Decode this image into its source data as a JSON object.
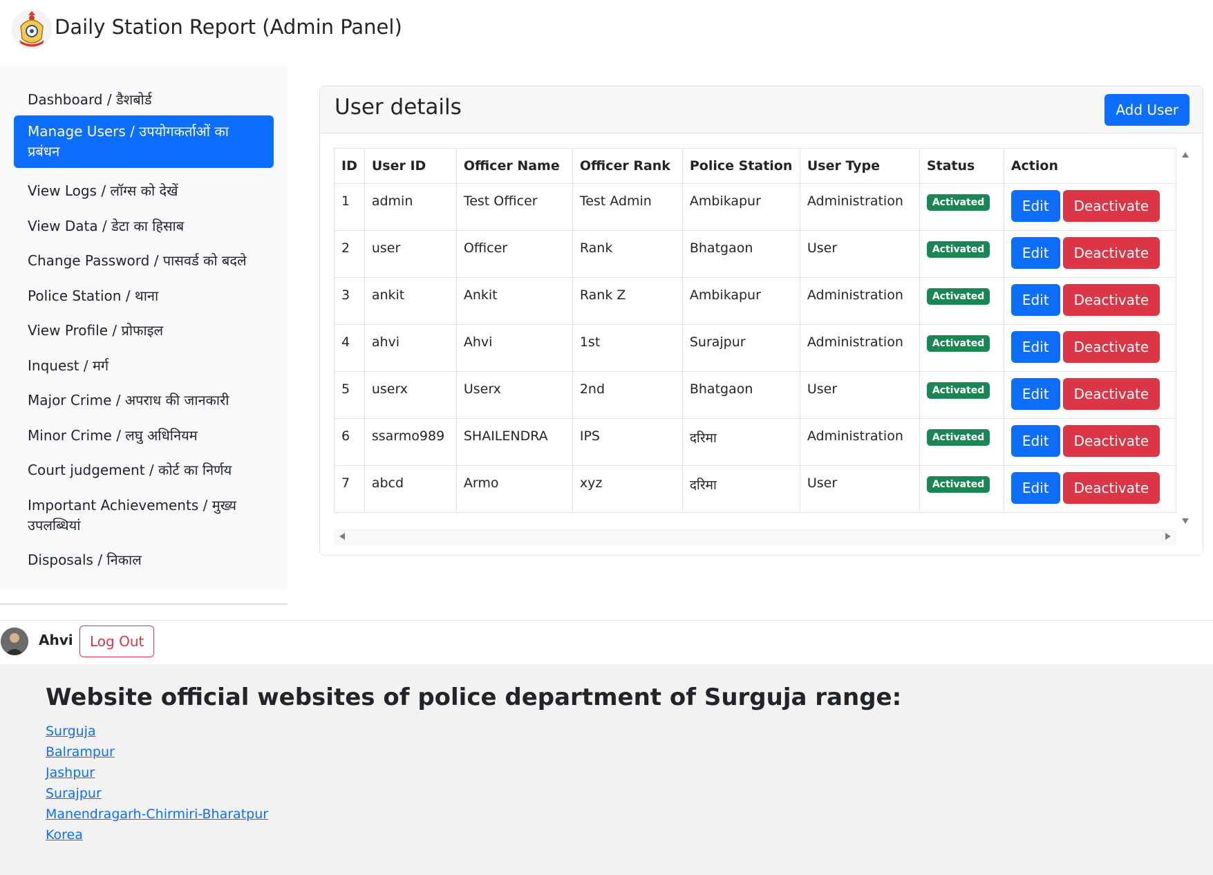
{
  "header": {
    "title": "Daily Station Report (Admin Panel)"
  },
  "sidebar": {
    "items": [
      {
        "label": "Dashboard / डैशबोर्ड",
        "active": false
      },
      {
        "label": "Manage Users / उपयोगकर्ताओं का प्रबंधन",
        "active": true
      },
      {
        "label": "View Logs / लॉग्स को देखें",
        "active": false
      },
      {
        "label": "View Data / डेटा का हिसाब",
        "active": false
      },
      {
        "label": "Change Password / पासवर्ड को बदले",
        "active": false
      },
      {
        "label": "Police Station / थाना",
        "active": false
      },
      {
        "label": "View Profile / प्रोफाइल",
        "active": false
      },
      {
        "label": "Inquest / मर्ग",
        "active": false
      },
      {
        "label": "Major Crime / अपराध की जानकारी",
        "active": false
      },
      {
        "label": "Minor Crime / लघु अधिनियम",
        "active": false
      },
      {
        "label": "Court judgement / कोर्ट का निर्णय",
        "active": false
      },
      {
        "label": "Important Achievements / मुख्य उपलब्धियां",
        "active": false
      },
      {
        "label": "Disposals / निकाल",
        "active": false
      }
    ]
  },
  "card": {
    "title": "User details",
    "add_button": "Add User"
  },
  "table": {
    "headers": [
      "ID",
      "User ID",
      "Officer Name",
      "Officer Rank",
      "Police Station",
      "User Type",
      "Status",
      "Action"
    ],
    "rows": [
      {
        "id": "1",
        "user_id": "admin",
        "officer_name": "Test Officer",
        "officer_rank": "Test Admin",
        "police_station": "Ambikapur",
        "user_type": "Administration",
        "status": "Activated"
      },
      {
        "id": "2",
        "user_id": "user",
        "officer_name": "Officer",
        "officer_rank": "Rank",
        "police_station": "Bhatgaon",
        "user_type": "User",
        "status": "Activated"
      },
      {
        "id": "3",
        "user_id": "ankit",
        "officer_name": "Ankit",
        "officer_rank": "Rank Z",
        "police_station": "Ambikapur",
        "user_type": "Administration",
        "status": "Activated"
      },
      {
        "id": "4",
        "user_id": "ahvi",
        "officer_name": "Ahvi",
        "officer_rank": "1st",
        "police_station": "Surajpur",
        "user_type": "Administration",
        "status": "Activated"
      },
      {
        "id": "5",
        "user_id": "userx",
        "officer_name": "Userx",
        "officer_rank": "2nd",
        "police_station": "Bhatgaon",
        "user_type": "User",
        "status": "Activated"
      },
      {
        "id": "6",
        "user_id": "ssarmo989",
        "officer_name": "SHAILENDRA",
        "officer_rank": "IPS",
        "police_station": "दरिमा",
        "user_type": "Administration",
        "status": "Activated"
      },
      {
        "id": "7",
        "user_id": "abcd",
        "officer_name": "Armo",
        "officer_rank": "xyz",
        "police_station": "दरिमा",
        "user_type": "User",
        "status": "Activated"
      }
    ],
    "edit_label": "Edit",
    "deactivate_label": "Deactivate"
  },
  "userbar": {
    "name": "Ahvi",
    "logout_label": "Log Out"
  },
  "footer": {
    "heading": "Website official websites of police department of Surguja range:",
    "links": [
      "Surguja",
      "Balrampur",
      "Jashpur",
      "Surajpur",
      "Manendragarh-Chirmiri-Bharatpur",
      "Korea"
    ]
  },
  "colors": {
    "primary": "#0d6efd",
    "danger": "#dc3545",
    "success": "#198754",
    "sidebar_bg": "#f8f9fa",
    "footer_bg": "#f2f2f2"
  },
  "icons": {
    "logo": "police-emblem-icon",
    "avatar": "user-avatar-icon"
  }
}
